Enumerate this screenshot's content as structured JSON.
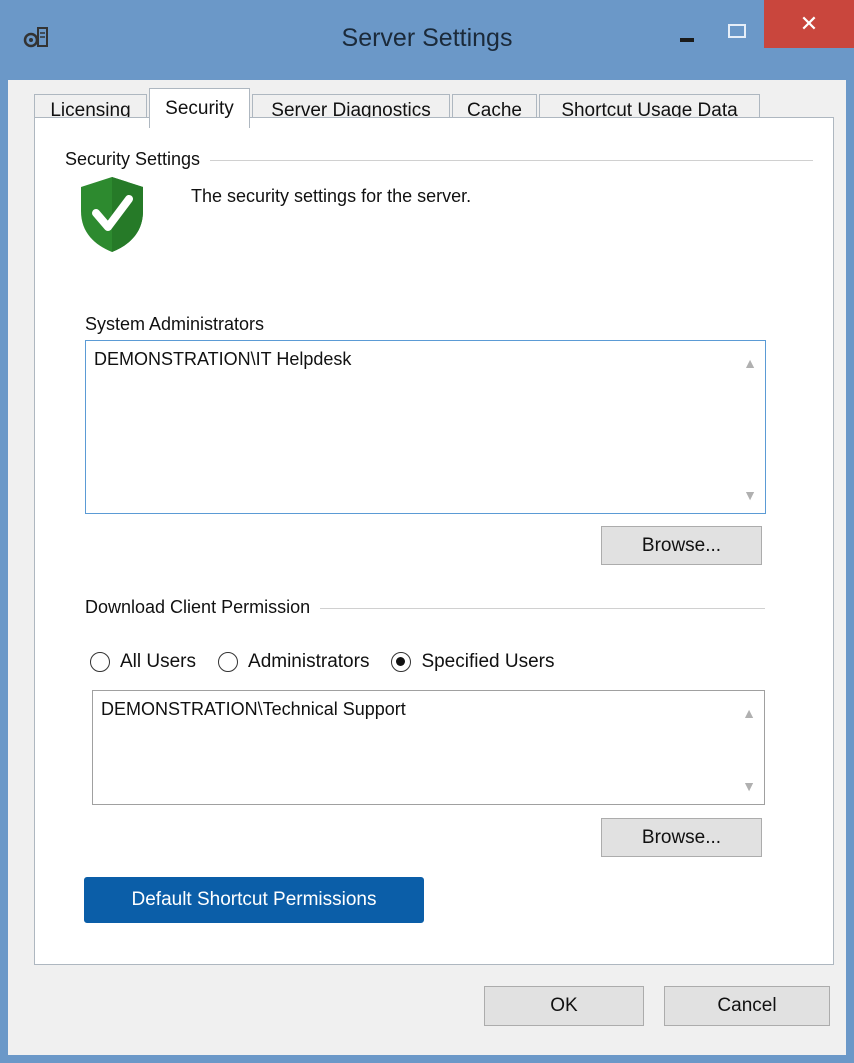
{
  "window": {
    "title": "Server Settings",
    "close_glyph": "✕"
  },
  "tabs": [
    {
      "label": "Licensing"
    },
    {
      "label": "Security"
    },
    {
      "label": "Server Diagnostics"
    },
    {
      "label": "Cache"
    },
    {
      "label": "Shortcut Usage Data"
    }
  ],
  "security": {
    "group_title": "Security Settings",
    "description": "The security settings for the server.",
    "shield_icon": "shield-check-icon",
    "shield_color": "#2d8a2f"
  },
  "system_admins": {
    "label": "System Administrators",
    "value": "DEMONSTRATION\\IT Helpdesk",
    "browse_label": "Browse..."
  },
  "download_permission": {
    "group_title": "Download Client Permission",
    "options": [
      "All Users",
      "Administrators",
      "Specified Users"
    ],
    "selected": "Specified Users",
    "value": "DEMONSTRATION\\Technical Support",
    "browse_label": "Browse..."
  },
  "default_shortcut_button": "Default Shortcut Permissions",
  "footer": {
    "ok": "OK",
    "cancel": "Cancel"
  }
}
